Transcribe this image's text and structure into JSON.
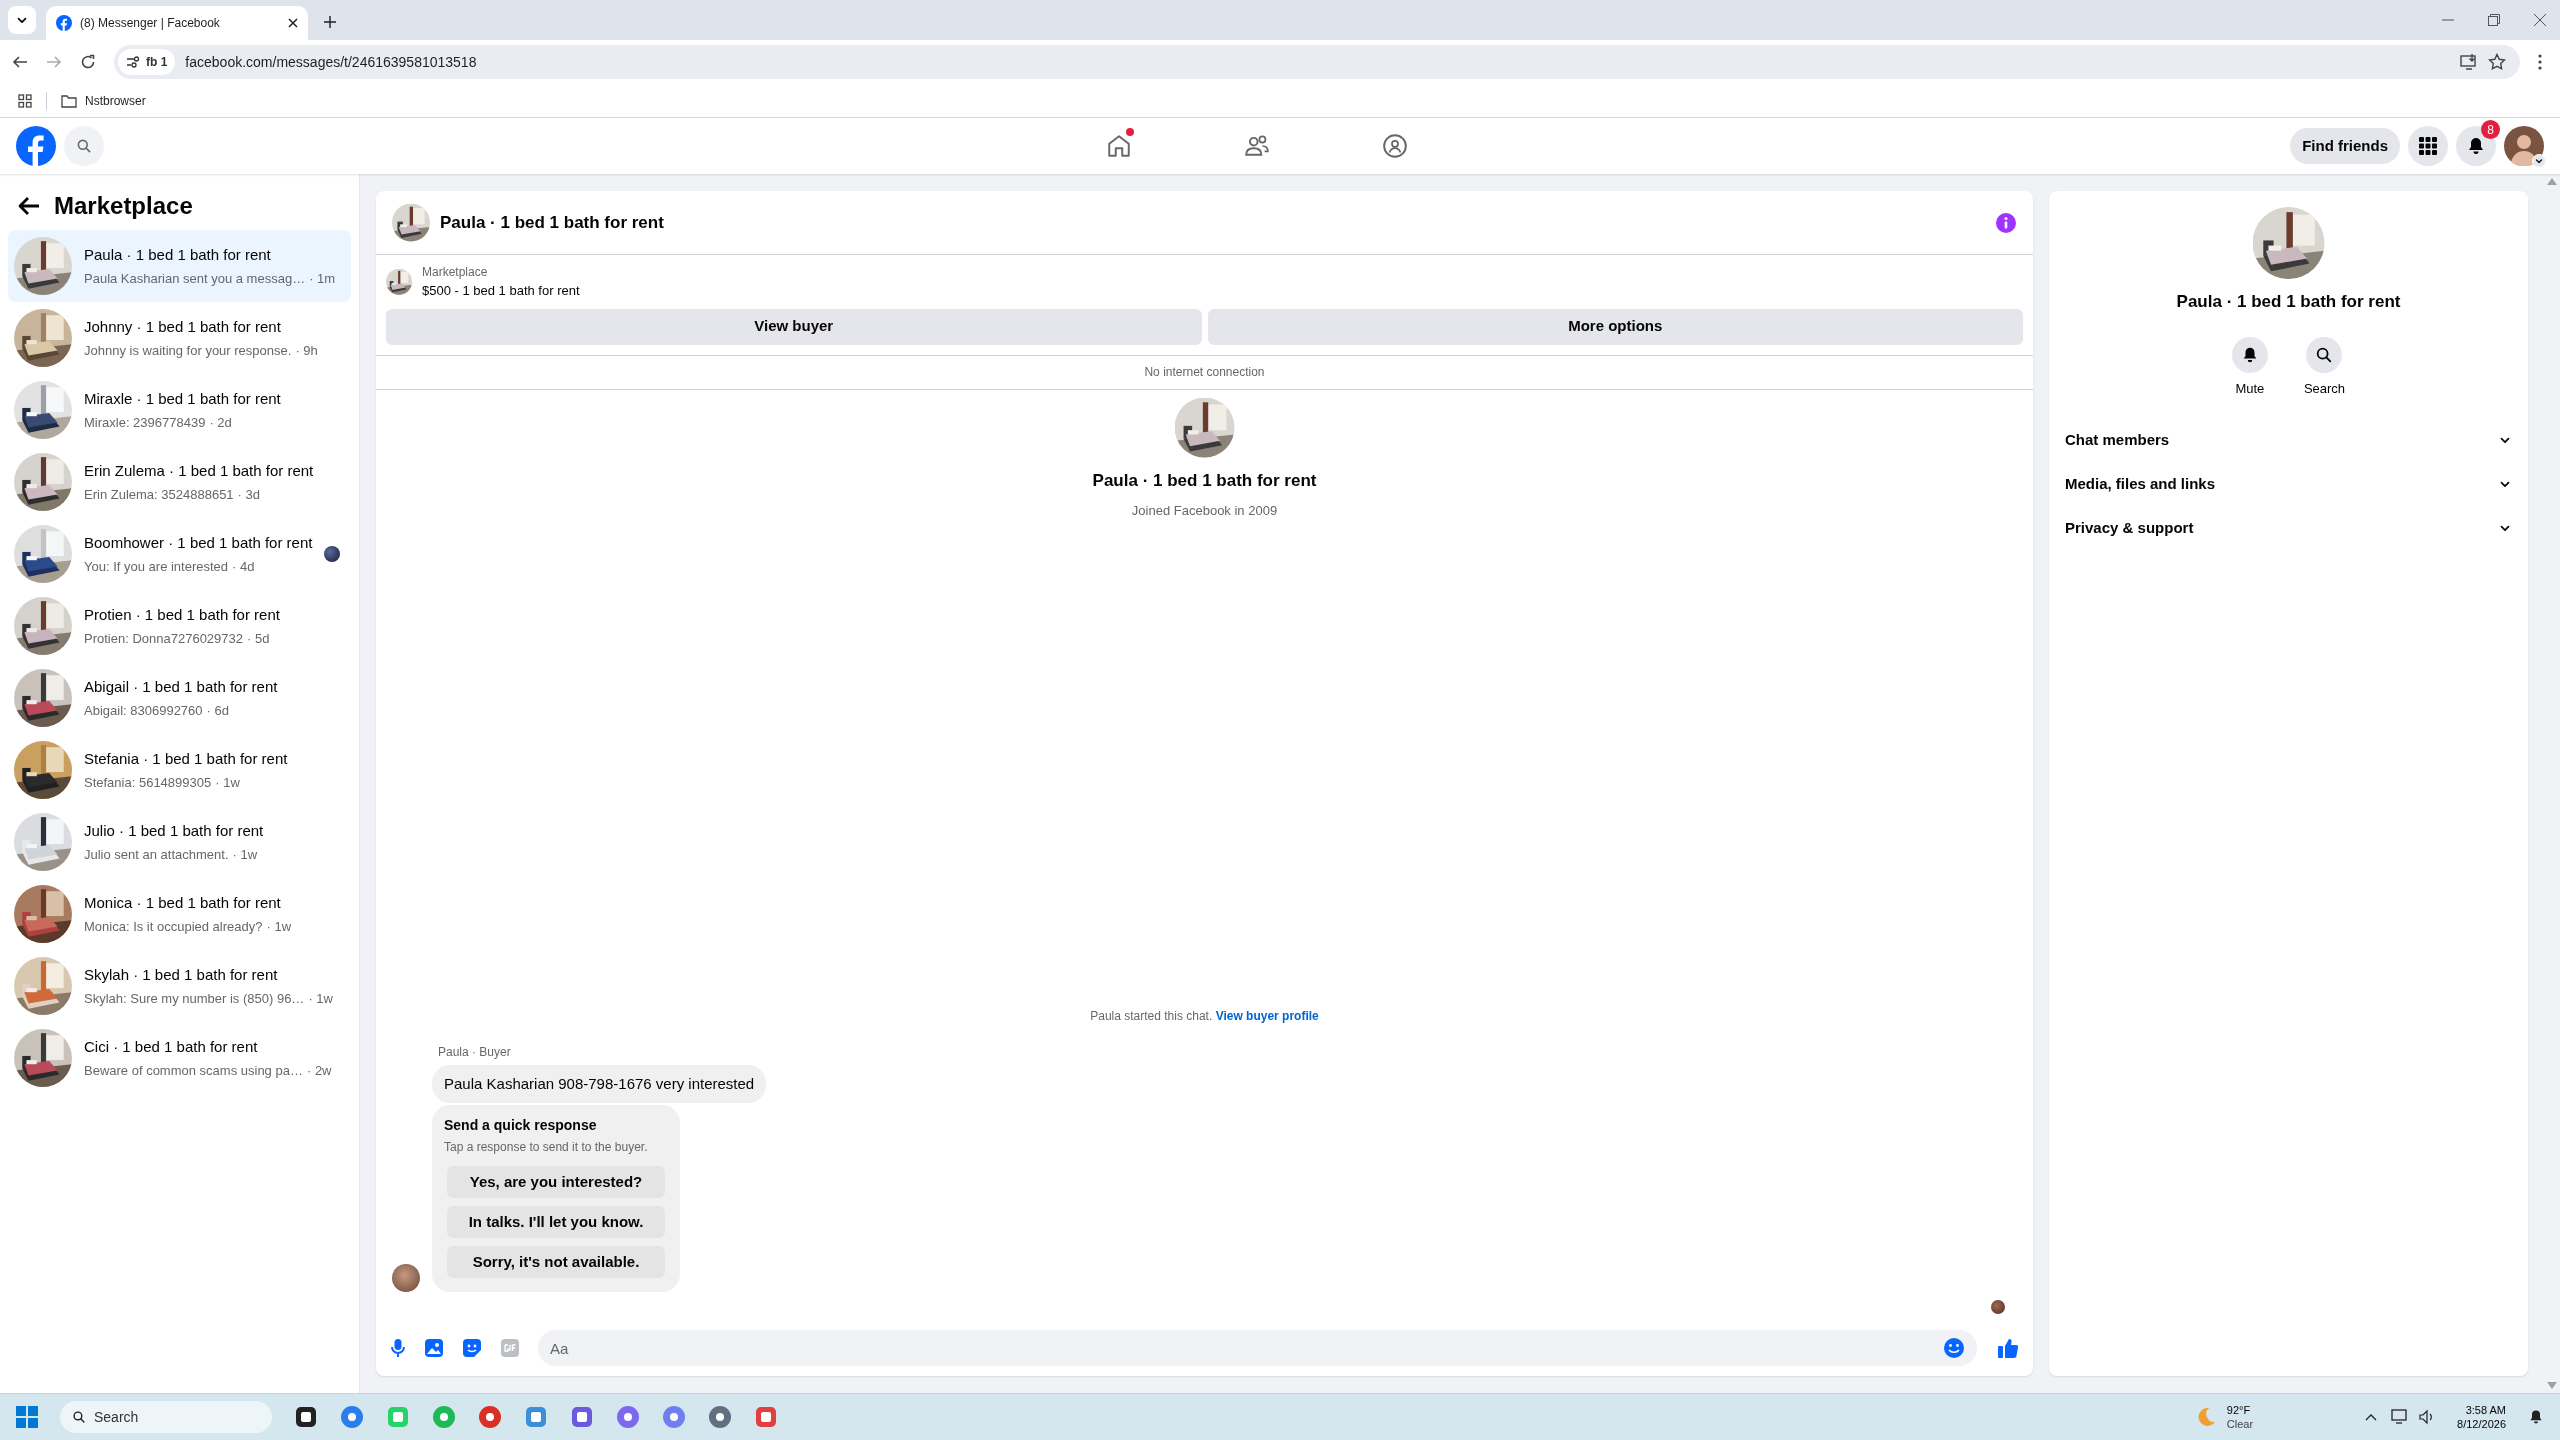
{
  "browser": {
    "tab_title": "(8) Messenger | Facebook",
    "profile_chip": "fb 1",
    "url": "facebook.com/messages/t/2461639581013518",
    "bookmarks": [
      "Nstbrowser"
    ]
  },
  "facebook_header": {
    "home_notification_dot": true,
    "find_friends": "Find friends",
    "notification_count": "8"
  },
  "sidebar": {
    "title": "Marketplace",
    "conversations": [
      {
        "title": "Paula · 1 bed 1 bath for rent",
        "preview": "Paula Kasharian sent you a messag…",
        "time": "· 1m",
        "selected": true,
        "seen_avatar": false
      },
      {
        "title": "Johnny · 1 bed 1 bath for rent",
        "preview": "Johnny is waiting for your response.",
        "time": "· 9h",
        "selected": false,
        "seen_avatar": false
      },
      {
        "title": "Miraxle · 1 bed 1 bath for rent",
        "preview": "Miraxle: 2396778439",
        "time": "· 2d",
        "selected": false,
        "seen_avatar": false
      },
      {
        "title": "Erin Zulema · 1 bed 1 bath for rent",
        "preview": "Erin Zulema: 3524888651",
        "time": "· 3d",
        "selected": false,
        "seen_avatar": false
      },
      {
        "title": "Boomhower · 1 bed 1 bath for rent",
        "preview": "You: If you are interested",
        "time": "· 4d",
        "selected": false,
        "seen_avatar": true
      },
      {
        "title": "Protien · 1 bed 1 bath for rent",
        "preview": "Protien: Donna7276029732",
        "time": "· 5d",
        "selected": false,
        "seen_avatar": false
      },
      {
        "title": "Abigail · 1 bed 1 bath for rent",
        "preview": "Abigail: 8306992760",
        "time": "· 6d",
        "selected": false,
        "seen_avatar": false
      },
      {
        "title": "Stefania · 1 bed 1 bath for rent",
        "preview": "Stefania: 5614899305",
        "time": "· 1w",
        "selected": false,
        "seen_avatar": false
      },
      {
        "title": "Julio · 1 bed 1 bath for rent",
        "preview": "Julio sent an attachment.",
        "time": "· 1w",
        "selected": false,
        "seen_avatar": false
      },
      {
        "title": "Monica · 1 bed 1 bath for rent",
        "preview": "Monica: Is it occupied already?",
        "time": "· 1w",
        "selected": false,
        "seen_avatar": false
      },
      {
        "title": "Skylah · 1 bed 1 bath for rent",
        "preview": "Skylah: Sure my number is (850) 96…",
        "time": "· 1w",
        "selected": false,
        "seen_avatar": false
      },
      {
        "title": "Cici · 1 bed 1 bath for rent",
        "preview": "Beware of common scams using pa…",
        "time": "· 2w",
        "selected": false,
        "seen_avatar": false
      }
    ]
  },
  "chat": {
    "title": "Paula · 1 bed 1 bath for rent",
    "listing_label": "Marketplace",
    "listing": "$500 - 1 bed 1 bath for rent",
    "buttons": [
      "View buyer",
      "More options"
    ],
    "banner": "No internet connection",
    "profile": {
      "name": "Paula · 1 bed 1 bath for rent",
      "joined": "Joined Facebook in 2009"
    },
    "started_text": "Paula started this chat.",
    "started_link": "View buyer profile",
    "sender": "Paula · Buyer",
    "message": "Paula Kasharian 908-798-1676 very interested",
    "quick_response": {
      "title": "Send a quick response",
      "subtitle": "Tap a response to send it to the buyer.",
      "options": [
        "Yes, are you interested?",
        "In talks. I'll let you know.",
        "Sorry, it's not available."
      ]
    },
    "composer": {
      "placeholder": "Aa"
    }
  },
  "details": {
    "name": "Paula · 1 bed 1 bath for rent",
    "actions": [
      {
        "label": "Mute",
        "kind": "bell"
      },
      {
        "label": "Search",
        "kind": "search"
      }
    ],
    "sections": [
      {
        "label": "Chat members",
        "expanded": false
      },
      {
        "label": "Media, files and links",
        "expanded": false
      },
      {
        "label": "Privacy & support",
        "expanded": false
      }
    ]
  },
  "taskbar": {
    "search_placeholder": "Search",
    "weather": {
      "temperature": "92°F",
      "condition": "Clear"
    },
    "time": "3:58 AM",
    "date": "8/12/2026"
  }
}
